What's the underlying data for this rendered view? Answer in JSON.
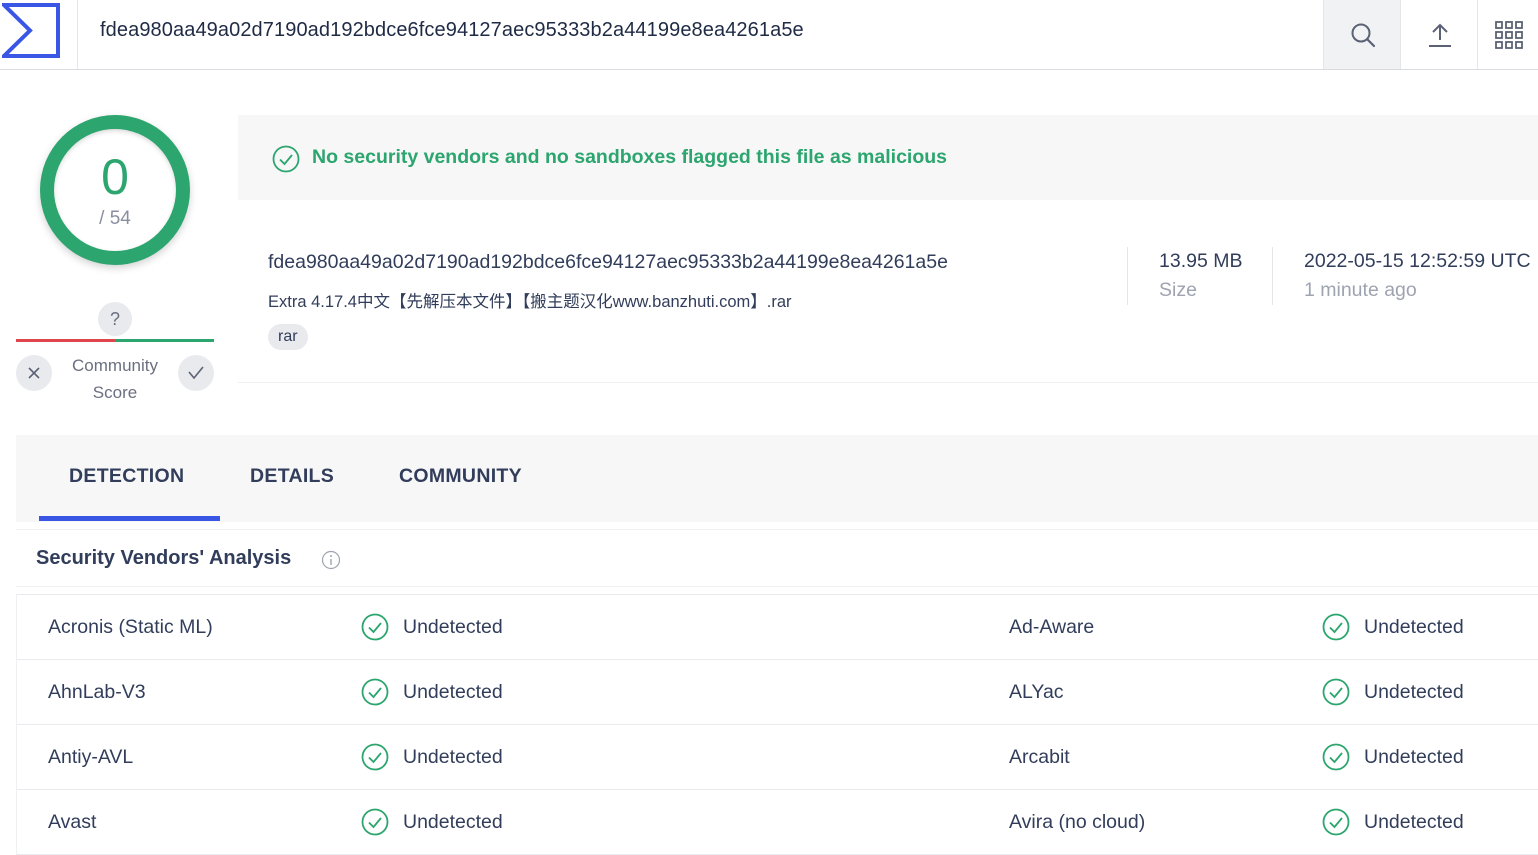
{
  "header": {
    "search_value": "fdea980aa49a02d7190ad192bdce6fce94127aec95333b2a44199e8ea4261a5e"
  },
  "score": {
    "detections": "0",
    "total": "/ 54"
  },
  "community": {
    "unknown": "?",
    "label_line1": "Community",
    "label_line2": "Score"
  },
  "verdict": {
    "text": "No security vendors and no sandboxes flagged this file as malicious"
  },
  "file": {
    "hash": "fdea980aa49a02d7190ad192bdce6fce94127aec95333b2a44199e8ea4261a5e",
    "name": "Extra 4.17.4中文【先解压本文件】【搬主题汉化www.banzhuti.com】.rar",
    "tag": "rar",
    "size_value": "13.95 MB",
    "size_label": "Size",
    "date_value": "2022-05-15 12:52:59 UTC",
    "date_relative": "1 minute ago"
  },
  "tabs": [
    "DETECTION",
    "DETAILS",
    "COMMUNITY"
  ],
  "analysis": {
    "title": "Security Vendors' Analysis",
    "rows": [
      {
        "left_vendor": "Acronis (Static ML)",
        "left_result": "Undetected",
        "right_vendor": "Ad-Aware",
        "right_result": "Undetected"
      },
      {
        "left_vendor": "AhnLab-V3",
        "left_result": "Undetected",
        "right_vendor": "ALYac",
        "right_result": "Undetected"
      },
      {
        "left_vendor": "Antiy-AVL",
        "left_result": "Undetected",
        "right_vendor": "Arcabit",
        "right_result": "Undetected"
      },
      {
        "left_vendor": "Avast",
        "left_result": "Undetected",
        "right_vendor": "Avira (no cloud)",
        "right_result": "Undetected"
      }
    ]
  },
  "colors": {
    "clean_green": "#2ca56e",
    "accent_blue": "#3a56e4",
    "malicious_red": "#e0474c"
  },
  "icons": [
    "sigma-logo-icon",
    "search-icon",
    "upload-icon",
    "apps-grid-icon",
    "check-circle-icon",
    "close-icon",
    "check-icon",
    "info-icon"
  ]
}
